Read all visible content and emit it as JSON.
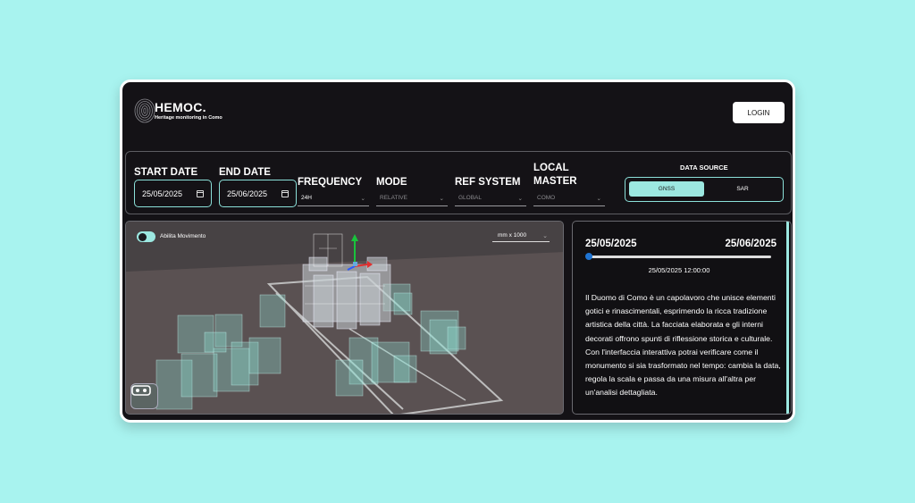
{
  "header": {
    "app_name": "HEMOC.",
    "app_subtitle": "Heritage monitoring in Como",
    "login_label": "LOGIN",
    "logo_icon": "fingerprint-logo-icon"
  },
  "filters": {
    "start_date": {
      "label": "START DATE",
      "value": "25/05/2025"
    },
    "end_date": {
      "label": "END DATE",
      "value": "25/06/2025"
    },
    "frequency": {
      "label": "FREQUENCY",
      "value": "24H"
    },
    "mode": {
      "label": "MODE",
      "value": "RELATIVE"
    },
    "ref_system": {
      "label": "REF SYSTEM",
      "value": "GLOBAL"
    },
    "local_master": {
      "label_line1": "LOCAL",
      "label_line2": "MASTER",
      "value": "COMO"
    },
    "data_source": {
      "title": "DATA SOURCE",
      "options": [
        "GNSS",
        "SAR"
      ],
      "selected": "GNSS"
    }
  },
  "viewer": {
    "movement_toggle_label": "Abilita Movimento",
    "movement_enabled": true,
    "scale_value": "mm x 1000",
    "vr_icon": "vr-headset-icon"
  },
  "panel": {
    "range_start": "25/05/2025",
    "range_end": "25/06/2025",
    "slider_position": 0.0,
    "current_timestamp": "25/05/2025 12:00:00",
    "description": "Il Duomo di Como è un capolavoro che unisce elementi gotici e rinascimentali, esprimendo la ricca tradizione artistica della città. La facciata elaborata e gli interni decorati offrono spunti di riflessione storica e culturale. Con l'interfaccia interattiva potrai verificare come il monumento si sia trasformato nel tempo: cambia la data, regola la scala e passa da una misura all'altra per un'analisi dettagliata."
  },
  "colors": {
    "page_background": "#a8f3ef",
    "app_background": "#141216",
    "accent": "#8be0d9",
    "slider_thumb": "#1f74d3"
  }
}
